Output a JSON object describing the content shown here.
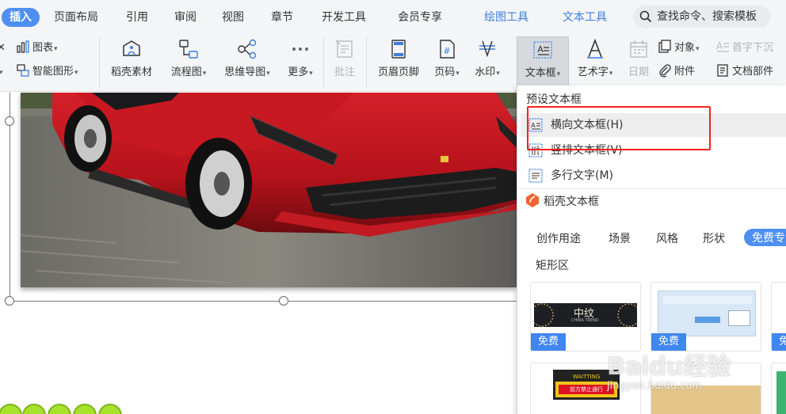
{
  "tabs": [
    {
      "label": "插入",
      "active": true
    },
    {
      "label": "页面布局"
    },
    {
      "label": "引用"
    },
    {
      "label": "审阅"
    },
    {
      "label": "视图"
    },
    {
      "label": "章节"
    },
    {
      "label": "开发工具"
    },
    {
      "label": "会员专享"
    },
    {
      "label": "绘图工具",
      "contextual": true
    },
    {
      "label": "文本工具",
      "contextual": true
    }
  ],
  "search": {
    "placeholder": "查找命令、搜索模板"
  },
  "ribbon": {
    "chart": "图表",
    "smart_graphic": "智能图形",
    "daoke_material": "稻壳素材",
    "flowchart": "流程图",
    "mindmap": "思维导图",
    "more": "更多",
    "comment": "批注",
    "header_footer": "页眉页脚",
    "page_number": "页码",
    "watermark": "水印",
    "textbox": "文本框",
    "wordart": "艺术字",
    "date": "日期",
    "object": "对象",
    "drop_cap": "首字下沉",
    "attachment": "附件",
    "doc_parts": "文档部件"
  },
  "dropdown": {
    "preset_header": "预设文本框",
    "items": [
      {
        "label": "横向文本框(H)",
        "icon": "horizontal-textbox-icon",
        "hover": true
      },
      {
        "label": "竖排文本框(V)",
        "icon": "vertical-textbox-icon"
      },
      {
        "label": "多行文字(M)",
        "icon": "multiline-text-icon"
      }
    ],
    "daoke_section": "稻壳文本框",
    "filter_tabs": [
      "创作用途",
      "场景",
      "风格",
      "形状",
      "免费专"
    ],
    "subheading": "矩形区",
    "badge": "免费",
    "card1_text": "中纹",
    "card1_sub": "CHINA TREND",
    "card4_text": "WAITTING",
    "card4_sub": "前方禁止通行"
  },
  "watermark": {
    "main": "Baidu经验",
    "sub": "jingyan.baidu.com"
  },
  "colors": {
    "accent": "#4e8ff0",
    "contextual_tab": "#3d7fe0",
    "highlight": "#ff1f1f",
    "badge": "#3f86ee"
  }
}
